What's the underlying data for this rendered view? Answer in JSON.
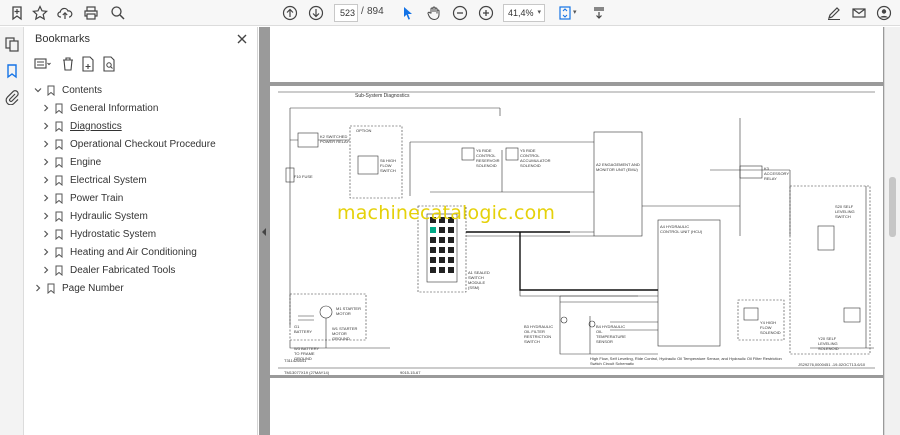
{
  "toolbar": {
    "current_page": "523",
    "page_separator": "/",
    "total_pages": "894",
    "zoom": "41,4%"
  },
  "bookmarks_panel": {
    "title": "Bookmarks",
    "items": [
      {
        "label": "Contents",
        "level": 0
      },
      {
        "label": "General Information",
        "level": 1
      },
      {
        "label": "Diagnostics",
        "level": 1
      },
      {
        "label": "Operational Checkout Procedure",
        "level": 1
      },
      {
        "label": "Engine",
        "level": 1
      },
      {
        "label": "Electrical System",
        "level": 1
      },
      {
        "label": "Power Train",
        "level": 1
      },
      {
        "label": "Hydraulic System",
        "level": 1
      },
      {
        "label": "Hydrostatic System",
        "level": 1
      },
      {
        "label": "Heating and Air Conditioning",
        "level": 1
      },
      {
        "label": "Dealer Fabricated Tools",
        "level": 1
      },
      {
        "label": "Page Number",
        "level": 0
      }
    ]
  },
  "document": {
    "page_header": "Sub-System Diagnostics",
    "watermark": "machinecatalogic.com",
    "figure_id": "T311426641",
    "footer_left": "TM13077X19 (27MAY14)",
    "footer_center": "9015-15-67",
    "caption": "High Flow, Self Leveling, Ride Control, Hydraulic Oil Temperature Sensor, and Hydraulic Oil Filter Restriction Switch Circuit Schematic",
    "drawing_ref": "JS29276,0000451 -19-02OCT13-6/10",
    "labels": {
      "switched_power_relay": "K2 SWITCHED POWER RELAY",
      "high_flow_switch": "S6 HIGH FLOW SWITCH",
      "ride_control_reservoir": "Y6 RIDE CONTROL RESERVOIR SOLENOID",
      "ride_control_accumulator": "Y5 RIDE CONTROL ACCUMULATOR SOLENOID",
      "ecu": "A2 ENGAGEMENT AND MONITOR UNIT (EMU)",
      "hydraulic_control_unit": "A4 HYDRAULIC CONTROL UNIT (HCU)",
      "sealed_switch_module": "A1 SEALED SWITCH MODULE (SSM)",
      "accessory_relay": "K3 ACCESSORY RELAY",
      "self_leveling_switch": "S20 SELF LEVELING SWITCH",
      "self_leveling_solenoid": "Y20 SELF LEVELING SOLENOID",
      "high_flow_solenoid": "Y4 HIGH FLOW SOLENOID",
      "starter_motor": "M1 STARTER MOTOR",
      "battery": "G1 BATTERY",
      "battery_to_frame": "W3 BATTERY TO FRAME GROUND",
      "starter_ground": "W1 STARTER MOTOR GROUND",
      "oil_filter_switch": "B3 HYDRAULIC OIL FILTER RESTRICTION SWITCH",
      "oil_temp_sensor": "B4 HYDRAULIC OIL TEMPERATURE SENSOR",
      "fuse": "F10 FUSE",
      "option": "OPTION"
    }
  }
}
